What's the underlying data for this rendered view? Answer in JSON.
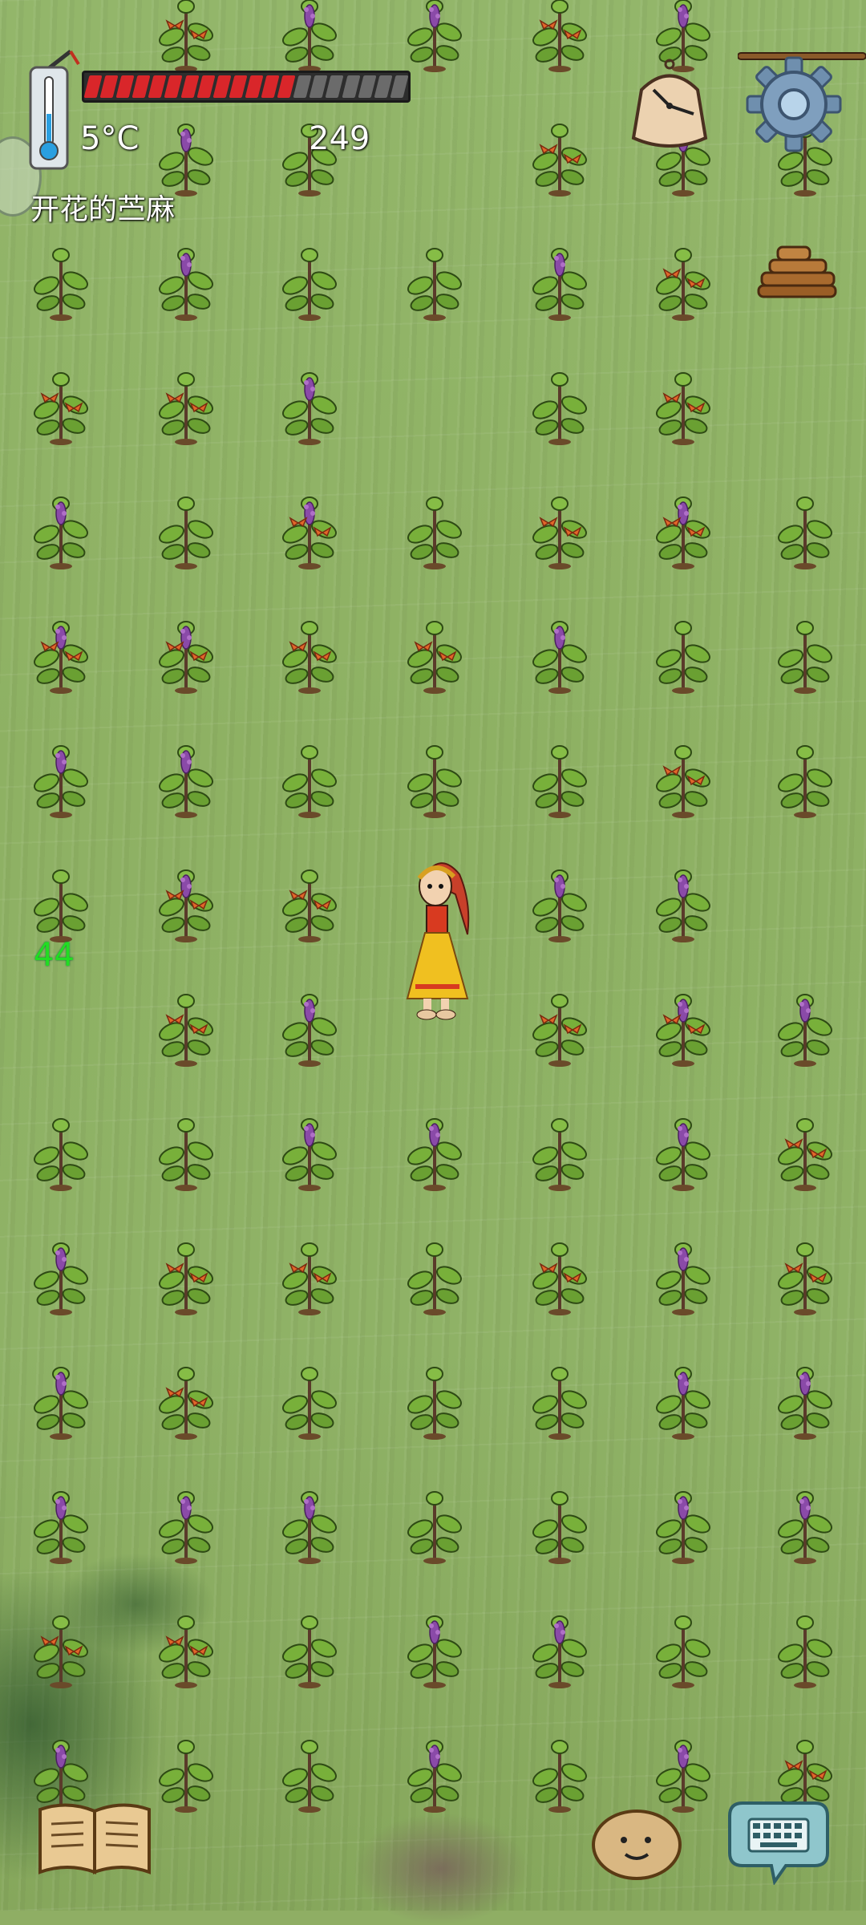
{
  "hud": {
    "temperature": "5°C",
    "age": "249",
    "hovered_object": "开花的苎麻",
    "hunger_counter": "44",
    "food": {
      "filled": 13,
      "total": 20
    }
  },
  "icons": {
    "thermometer": "thermometer-icon",
    "clock": "clock-icon",
    "settings": "gear-icon",
    "tech_book": "book-icon",
    "emote": "potato-face-icon",
    "keyboard": "keyboard-icon",
    "logs": "log-pile-icon"
  },
  "colors": {
    "food_full": "#d9262a",
    "food_empty": "#6b6b6b",
    "hunger_text": "#22dd22",
    "ground": "#8fb266"
  },
  "field": {
    "rows": [
      [
        "",
        "o",
        "p",
        "p",
        "o",
        "p",
        ""
      ],
      [
        "",
        "p",
        "g",
        "",
        "o",
        "p",
        "g"
      ],
      [
        "g",
        "p",
        "g",
        "g",
        "p",
        "o",
        ""
      ],
      [
        "o",
        "o",
        "p",
        "",
        "g",
        "o",
        ""
      ],
      [
        "p",
        "g",
        "m",
        "g",
        "o",
        "m",
        "g"
      ],
      [
        "m",
        "m",
        "o",
        "o",
        "p",
        "g",
        "g"
      ],
      [
        "p",
        "p",
        "g",
        "g",
        "g",
        "o",
        "g"
      ],
      [
        "g",
        "m",
        "o",
        "",
        "p",
        "p",
        ""
      ],
      [
        "",
        "o",
        "p",
        "",
        "o",
        "m",
        "p"
      ],
      [
        "g",
        "g",
        "p",
        "p",
        "g",
        "p",
        "o"
      ],
      [
        "p",
        "o",
        "o",
        "g",
        "o",
        "p",
        "o"
      ],
      [
        "p",
        "o",
        "g",
        "g",
        "g",
        "p",
        "p"
      ],
      [
        "p",
        "p",
        "p",
        "g",
        "g",
        "p",
        "p"
      ],
      [
        "o",
        "o",
        "g",
        "p",
        "p",
        "g",
        "g"
      ],
      [
        "p",
        "g",
        "g",
        "p",
        "g",
        "p",
        "o"
      ]
    ]
  }
}
